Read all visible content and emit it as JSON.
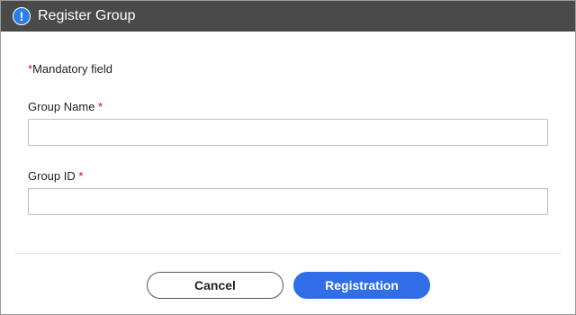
{
  "dialog": {
    "title": "Register Group",
    "title_icon": "info-icon",
    "accent_color": "#2f6ee8"
  },
  "form": {
    "mandatory_marker": "*",
    "mandatory_note": "Mandatory field",
    "group_name_label": "Group Name",
    "group_name_value": "",
    "group_id_label": "Group ID",
    "group_id_value": ""
  },
  "buttons": {
    "cancel_label": "Cancel",
    "registration_label": "Registration"
  }
}
